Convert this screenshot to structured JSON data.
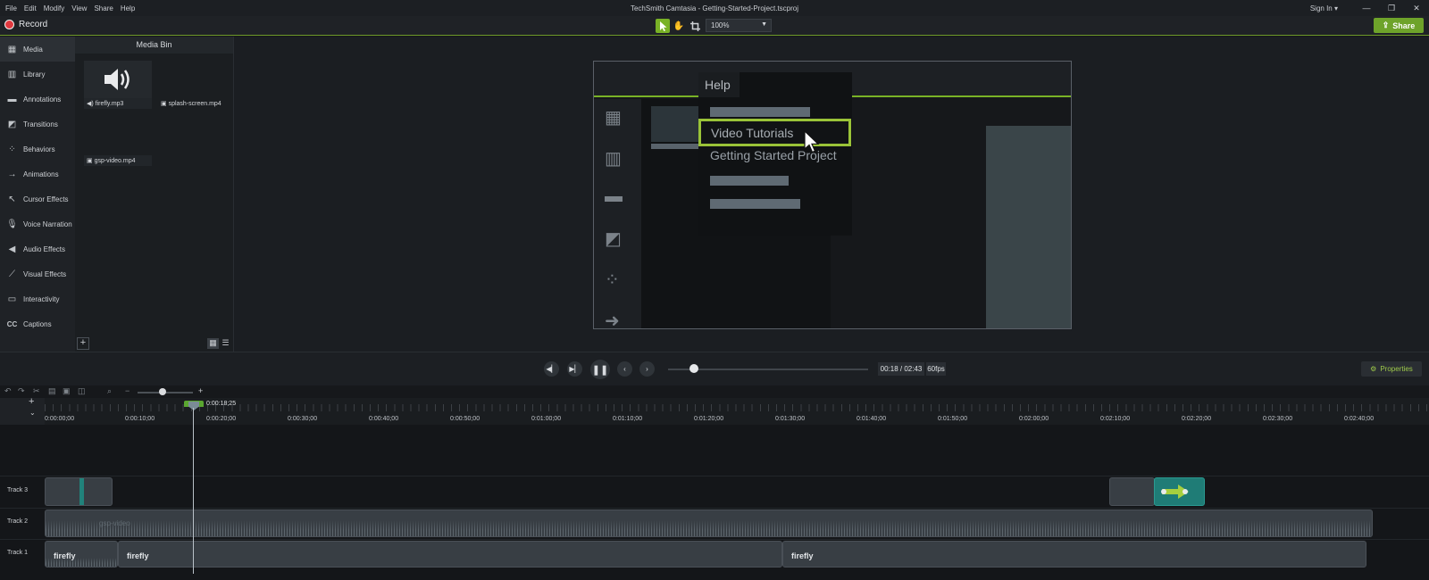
{
  "window": {
    "title": "TechSmith Camtasia - Getting-Started-Project.tscproj",
    "menu": [
      "File",
      "Edit",
      "Modify",
      "View",
      "Share",
      "Help"
    ],
    "sign_in": "Sign In ▾"
  },
  "toolbar": {
    "record_label": "Record",
    "zoom_value": "100%",
    "share_label": "Share"
  },
  "sidebar": {
    "items": [
      {
        "label": "Media",
        "icon": "film-icon"
      },
      {
        "label": "Library",
        "icon": "library-icon"
      },
      {
        "label": "Annotations",
        "icon": "annotation-icon"
      },
      {
        "label": "Transitions",
        "icon": "transition-icon"
      },
      {
        "label": "Behaviors",
        "icon": "behaviors-icon"
      },
      {
        "label": "Animations",
        "icon": "animation-icon"
      },
      {
        "label": "Cursor Effects",
        "icon": "cursor-effects-icon"
      },
      {
        "label": "Voice Narration",
        "icon": "microphone-icon"
      },
      {
        "label": "Audio Effects",
        "icon": "speaker-icon"
      },
      {
        "label": "Visual Effects",
        "icon": "wand-icon"
      },
      {
        "label": "Interactivity",
        "icon": "interactivity-icon"
      },
      {
        "label": "Captions",
        "icon": "captions-icon"
      }
    ]
  },
  "media_bin": {
    "title": "Media Bin",
    "items": [
      "firefly.mp3",
      "splash-screen.mp4",
      "gsp-video.mp4"
    ]
  },
  "canvas": {
    "help_menu_title": "Help",
    "highlighted_item": "Video Tutorials",
    "second_item": "Getting Started Project"
  },
  "transport": {
    "time": "00:18 / 02:43",
    "fps": "60fps",
    "properties_label": "Properties",
    "playback_progress": 0.11
  },
  "timeline": {
    "playhead_time": "0:00:18;25",
    "ruler_labels": [
      "0:00:00;00",
      "0:00:10;00",
      "0:00:20;00",
      "0:00:30;00",
      "0:00:40;00",
      "0:00:50;00",
      "0:01:00;00",
      "0:01:10;00",
      "0:01:20;00",
      "0:01:30;00",
      "0:01:40;00",
      "0:01:50;00",
      "0:02:00;00",
      "0:02:10;00",
      "0:02:20;00",
      "0:02:30;00",
      "0:02:40;00"
    ],
    "tracks": [
      {
        "label": "Track 3"
      },
      {
        "label": "Track 2",
        "clip": "gsp-video"
      },
      {
        "label": "Track 1",
        "clips": [
          "firefly",
          "firefly",
          "firefly"
        ]
      }
    ]
  }
}
